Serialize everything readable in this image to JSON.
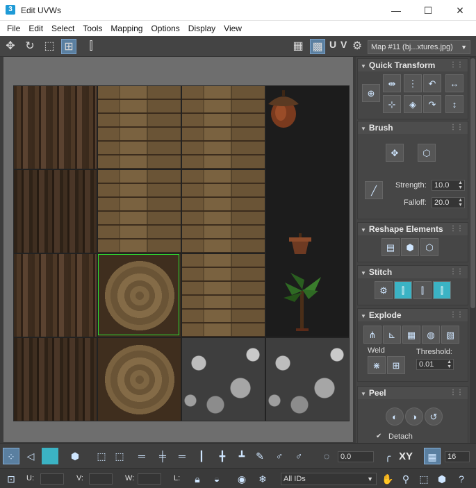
{
  "window": {
    "app_icon": "3",
    "title": "Edit UVWs",
    "minimize": "—",
    "maximize": "☐",
    "close": "✕"
  },
  "menu": [
    "File",
    "Edit",
    "Select",
    "Tools",
    "Mapping",
    "Options",
    "Display",
    "View"
  ],
  "toolbar": {
    "uv_label": "U V",
    "map_select": "Map #11 (bj...xtures.jpg)"
  },
  "quick_transform": {
    "title": "Quick Transform"
  },
  "brush": {
    "title": "Brush",
    "strength_label": "Strength:",
    "strength_value": "10.0",
    "falloff_label": "Falloff:",
    "falloff_value": "20.0"
  },
  "reshape_elements": {
    "title": "Reshape Elements"
  },
  "stitch": {
    "title": "Stitch"
  },
  "explode": {
    "title": "Explode",
    "weld_label": "Weld",
    "threshold_label": "Threshold:",
    "threshold_value": "0.01"
  },
  "peel": {
    "title": "Peel",
    "detach_label": "Detach",
    "detach_checked": true
  },
  "bottom": {
    "rotate_value": "0.0",
    "xy_label": "XY",
    "snap_value": "16",
    "u_label": "U:",
    "v_label": "V:",
    "w_label": "W:",
    "l_label": "L:",
    "ids_select": "All IDs"
  },
  "colors": {
    "selection_outline": "#30e030",
    "active_button": "#5a7fa0",
    "teal_button": "#3bb3c4"
  }
}
